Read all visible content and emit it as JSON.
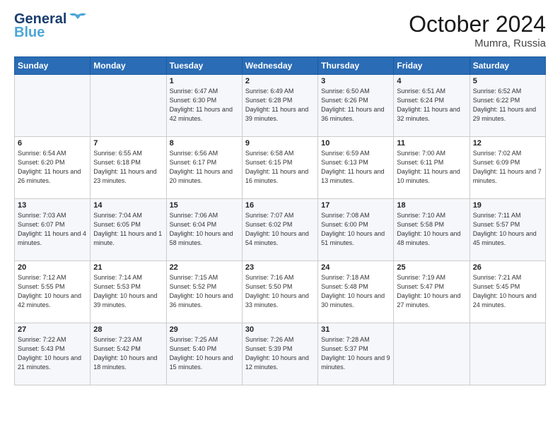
{
  "header": {
    "logo_general": "General",
    "logo_blue": "Blue",
    "month": "October 2024",
    "location": "Mumra, Russia"
  },
  "days_of_week": [
    "Sunday",
    "Monday",
    "Tuesday",
    "Wednesday",
    "Thursday",
    "Friday",
    "Saturday"
  ],
  "weeks": [
    [
      {
        "day": "",
        "info": ""
      },
      {
        "day": "",
        "info": ""
      },
      {
        "day": "1",
        "info": "Sunrise: 6:47 AM\nSunset: 6:30 PM\nDaylight: 11 hours and 42 minutes."
      },
      {
        "day": "2",
        "info": "Sunrise: 6:49 AM\nSunset: 6:28 PM\nDaylight: 11 hours and 39 minutes."
      },
      {
        "day": "3",
        "info": "Sunrise: 6:50 AM\nSunset: 6:26 PM\nDaylight: 11 hours and 36 minutes."
      },
      {
        "day": "4",
        "info": "Sunrise: 6:51 AM\nSunset: 6:24 PM\nDaylight: 11 hours and 32 minutes."
      },
      {
        "day": "5",
        "info": "Sunrise: 6:52 AM\nSunset: 6:22 PM\nDaylight: 11 hours and 29 minutes."
      }
    ],
    [
      {
        "day": "6",
        "info": "Sunrise: 6:54 AM\nSunset: 6:20 PM\nDaylight: 11 hours and 26 minutes."
      },
      {
        "day": "7",
        "info": "Sunrise: 6:55 AM\nSunset: 6:18 PM\nDaylight: 11 hours and 23 minutes."
      },
      {
        "day": "8",
        "info": "Sunrise: 6:56 AM\nSunset: 6:17 PM\nDaylight: 11 hours and 20 minutes."
      },
      {
        "day": "9",
        "info": "Sunrise: 6:58 AM\nSunset: 6:15 PM\nDaylight: 11 hours and 16 minutes."
      },
      {
        "day": "10",
        "info": "Sunrise: 6:59 AM\nSunset: 6:13 PM\nDaylight: 11 hours and 13 minutes."
      },
      {
        "day": "11",
        "info": "Sunrise: 7:00 AM\nSunset: 6:11 PM\nDaylight: 11 hours and 10 minutes."
      },
      {
        "day": "12",
        "info": "Sunrise: 7:02 AM\nSunset: 6:09 PM\nDaylight: 11 hours and 7 minutes."
      }
    ],
    [
      {
        "day": "13",
        "info": "Sunrise: 7:03 AM\nSunset: 6:07 PM\nDaylight: 11 hours and 4 minutes."
      },
      {
        "day": "14",
        "info": "Sunrise: 7:04 AM\nSunset: 6:05 PM\nDaylight: 11 hours and 1 minute."
      },
      {
        "day": "15",
        "info": "Sunrise: 7:06 AM\nSunset: 6:04 PM\nDaylight: 10 hours and 58 minutes."
      },
      {
        "day": "16",
        "info": "Sunrise: 7:07 AM\nSunset: 6:02 PM\nDaylight: 10 hours and 54 minutes."
      },
      {
        "day": "17",
        "info": "Sunrise: 7:08 AM\nSunset: 6:00 PM\nDaylight: 10 hours and 51 minutes."
      },
      {
        "day": "18",
        "info": "Sunrise: 7:10 AM\nSunset: 5:58 PM\nDaylight: 10 hours and 48 minutes."
      },
      {
        "day": "19",
        "info": "Sunrise: 7:11 AM\nSunset: 5:57 PM\nDaylight: 10 hours and 45 minutes."
      }
    ],
    [
      {
        "day": "20",
        "info": "Sunrise: 7:12 AM\nSunset: 5:55 PM\nDaylight: 10 hours and 42 minutes."
      },
      {
        "day": "21",
        "info": "Sunrise: 7:14 AM\nSunset: 5:53 PM\nDaylight: 10 hours and 39 minutes."
      },
      {
        "day": "22",
        "info": "Sunrise: 7:15 AM\nSunset: 5:52 PM\nDaylight: 10 hours and 36 minutes."
      },
      {
        "day": "23",
        "info": "Sunrise: 7:16 AM\nSunset: 5:50 PM\nDaylight: 10 hours and 33 minutes."
      },
      {
        "day": "24",
        "info": "Sunrise: 7:18 AM\nSunset: 5:48 PM\nDaylight: 10 hours and 30 minutes."
      },
      {
        "day": "25",
        "info": "Sunrise: 7:19 AM\nSunset: 5:47 PM\nDaylight: 10 hours and 27 minutes."
      },
      {
        "day": "26",
        "info": "Sunrise: 7:21 AM\nSunset: 5:45 PM\nDaylight: 10 hours and 24 minutes."
      }
    ],
    [
      {
        "day": "27",
        "info": "Sunrise: 7:22 AM\nSunset: 5:43 PM\nDaylight: 10 hours and 21 minutes."
      },
      {
        "day": "28",
        "info": "Sunrise: 7:23 AM\nSunset: 5:42 PM\nDaylight: 10 hours and 18 minutes."
      },
      {
        "day": "29",
        "info": "Sunrise: 7:25 AM\nSunset: 5:40 PM\nDaylight: 10 hours and 15 minutes."
      },
      {
        "day": "30",
        "info": "Sunrise: 7:26 AM\nSunset: 5:39 PM\nDaylight: 10 hours and 12 minutes."
      },
      {
        "day": "31",
        "info": "Sunrise: 7:28 AM\nSunset: 5:37 PM\nDaylight: 10 hours and 9 minutes."
      },
      {
        "day": "",
        "info": ""
      },
      {
        "day": "",
        "info": ""
      }
    ]
  ]
}
